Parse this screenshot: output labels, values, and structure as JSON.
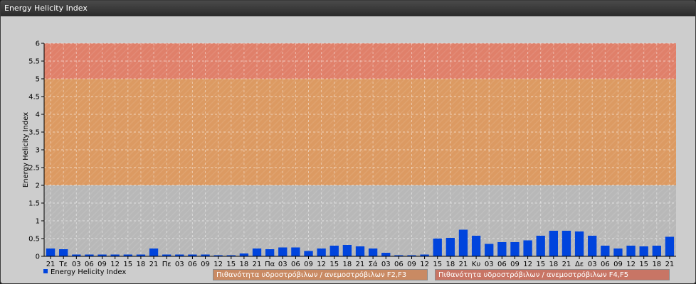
{
  "window": {
    "title": "Energy Helicity Index"
  },
  "chart_data": {
    "type": "bar",
    "ylabel": "Energy Helicity Index",
    "ylim": [
      0,
      6
    ],
    "yticks": [
      0,
      0.5,
      1,
      1.5,
      2,
      2.5,
      3,
      3.5,
      4,
      4.5,
      5,
      5.5,
      6
    ],
    "categories": [
      "21",
      "Τε",
      "03",
      "06",
      "09",
      "12",
      "15",
      "18",
      "21",
      "Πε",
      "03",
      "06",
      "09",
      "12",
      "15",
      "18",
      "21",
      "Πα",
      "03",
      "06",
      "09",
      "12",
      "15",
      "18",
      "21",
      "Σά",
      "03",
      "06",
      "09",
      "12",
      "15",
      "18",
      "21",
      "Κυ",
      "03",
      "06",
      "09",
      "12",
      "15",
      "18",
      "21",
      "Δε",
      "03",
      "06",
      "09",
      "12",
      "15",
      "18",
      "21"
    ],
    "series": [
      {
        "name": "Energy Helicity Index",
        "color": "#0044dd",
        "values": [
          0.22,
          0.2,
          0.05,
          0.05,
          0.05,
          0.05,
          0.05,
          0.05,
          0.22,
          0.05,
          0.05,
          0.05,
          0.05,
          0.03,
          0.03,
          0.08,
          0.22,
          0.2,
          0.25,
          0.25,
          0.15,
          0.22,
          0.3,
          0.32,
          0.28,
          0.22,
          0.1,
          0.03,
          0.03,
          0.05,
          0.5,
          0.52,
          0.75,
          0.58,
          0.35,
          0.4,
          0.4,
          0.45,
          0.58,
          0.72,
          0.72,
          0.7,
          0.58,
          0.3,
          0.22,
          0.3,
          0.28,
          0.3,
          0.55
        ]
      }
    ],
    "bands": [
      {
        "from": 0,
        "to": 2,
        "color": "#b8b8b8"
      },
      {
        "from": 2,
        "to": 5,
        "color": "#dc9a62"
      },
      {
        "from": 5,
        "to": 6,
        "color": "#e0806a"
      }
    ],
    "grid": true,
    "legend": [
      {
        "label": "Energy Helicity Index",
        "color": "#0044dd"
      },
      {
        "label": "Πιθανότητα υδροστρόβιλων / ανεμοστρόβιλων F2,F3",
        "color": "#c98a63"
      },
      {
        "label": "Πιθανότητα υδροστρόβιλων / ανεμοστρόβιλων F4,F5",
        "color": "#c87565"
      }
    ]
  }
}
